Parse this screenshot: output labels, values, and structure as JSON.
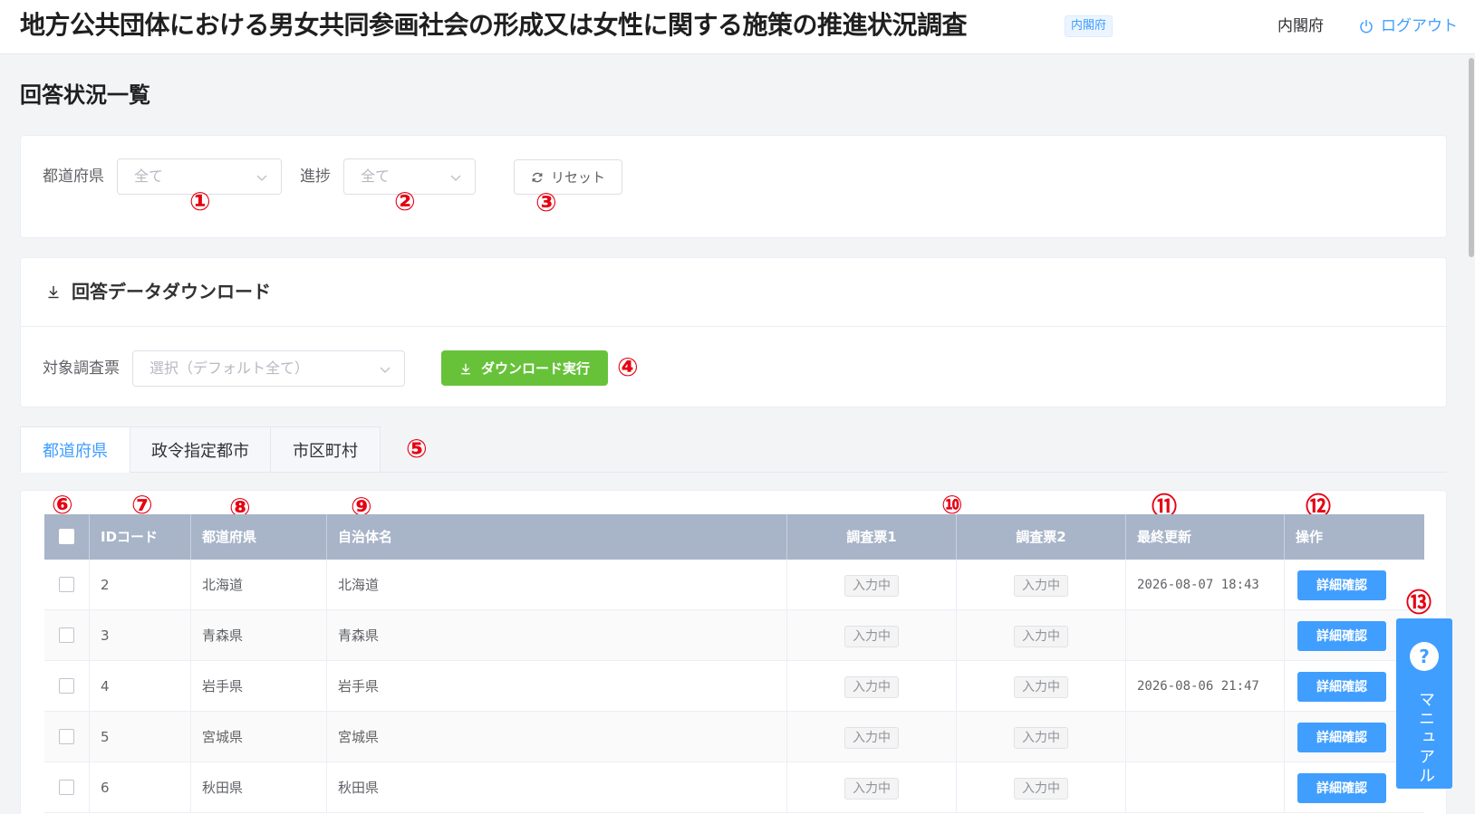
{
  "header": {
    "title": "地方公共団体における男女共同参画社会の形成又は女性に関する施策の推進状況調査",
    "badge": "内閣府",
    "org": "内閣府",
    "logout_label": "ログアウト"
  },
  "page": {
    "title": "回答状況一覧"
  },
  "filters": {
    "prefecture_label": "都道府県",
    "prefecture_value": "全て",
    "progress_label": "進捗",
    "progress_value": "全て",
    "reset_label": "リセット"
  },
  "download": {
    "title": "回答データダウンロード",
    "target_label": "対象調査票",
    "target_placeholder": "選択（デフォルト全て）",
    "button_label": "ダウンロード実行"
  },
  "tabs": [
    {
      "label": "都道府県",
      "active": true
    },
    {
      "label": "政令指定都市",
      "active": false
    },
    {
      "label": "市区町村",
      "active": false
    }
  ],
  "table": {
    "headers": [
      "IDコード",
      "都道府県",
      "自治体名",
      "調査票1",
      "調査票2",
      "最終更新",
      "操作"
    ],
    "rows": [
      {
        "id": "2",
        "prefecture": "北海道",
        "municipality": "北海道",
        "s1": "入力中",
        "s2": "入力中",
        "updated": "2026-08-07 18:43",
        "action": "詳細確認"
      },
      {
        "id": "3",
        "prefecture": "青森県",
        "municipality": "青森県",
        "s1": "入力中",
        "s2": "入力中",
        "updated": "",
        "action": "詳細確認"
      },
      {
        "id": "4",
        "prefecture": "岩手県",
        "municipality": "岩手県",
        "s1": "入力中",
        "s2": "入力中",
        "updated": "2026-08-06 21:47",
        "action": "詳細確認"
      },
      {
        "id": "5",
        "prefecture": "宮城県",
        "municipality": "宮城県",
        "s1": "入力中",
        "s2": "入力中",
        "updated": "",
        "action": "詳細確認"
      },
      {
        "id": "6",
        "prefecture": "秋田県",
        "municipality": "秋田県",
        "s1": "入力中",
        "s2": "入力中",
        "updated": "",
        "action": "詳細確認"
      }
    ]
  },
  "manual": {
    "icon": "?",
    "label": "マニュアル"
  },
  "markers": [
    "①",
    "②",
    "③",
    "④",
    "⑤",
    "⑥",
    "⑦",
    "⑧",
    "⑨",
    "⑩",
    "⑪",
    "⑫",
    "⑬"
  ],
  "colors": {
    "accent": "#409eff",
    "download": "#67c23a",
    "table_header": "#a8b4c8",
    "marker": "#e60012"
  },
  "icons": {
    "logout": "power-icon",
    "reset": "refresh-icon",
    "download": "download-icon",
    "select": "chevron-down-icon",
    "manual": "help-icon"
  }
}
